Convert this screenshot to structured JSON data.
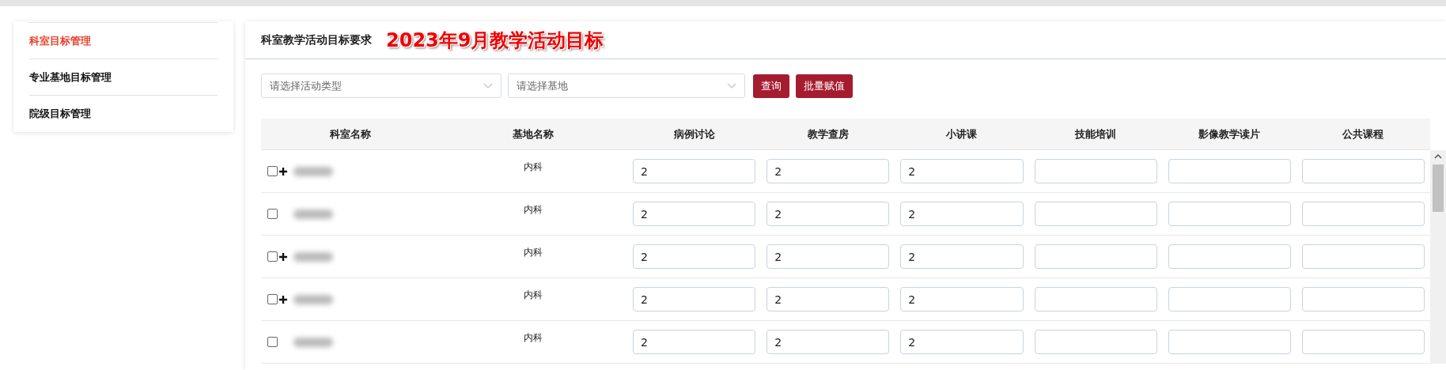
{
  "sidebar": {
    "items": [
      {
        "label": "科室目标管理",
        "selected": true
      },
      {
        "label": "专业基地目标管理",
        "selected": false
      },
      {
        "label": "院级目标管理",
        "selected": false
      }
    ]
  },
  "panel": {
    "title": "科室教学活动目标要求",
    "highlight": "2023年9月教学活动目标"
  },
  "filters": [
    {
      "placeholder": "请选择活动类型"
    },
    {
      "placeholder": "请选择基地"
    }
  ],
  "buttons": [
    "查询",
    "批量赋值"
  ],
  "table": {
    "columns": [
      "科室名称",
      "基地名称",
      "病例讨论",
      "教学查房",
      "小讲课",
      "技能培训",
      "影像教学读片",
      "公共课程"
    ],
    "rows": [
      {
        "checked": false,
        "expandable": true,
        "base": "内科",
        "values": [
          "2",
          "2",
          "2"
        ]
      },
      {
        "checked": false,
        "expandable": false,
        "base": "内科",
        "values": [
          "2",
          "2",
          "2"
        ]
      },
      {
        "checked": false,
        "expandable": true,
        "base": "内科",
        "values": [
          "2",
          "2",
          "2"
        ]
      },
      {
        "checked": false,
        "expandable": true,
        "base": "内科",
        "values": [
          "2",
          "2",
          "2"
        ]
      },
      {
        "checked": false,
        "expandable": false,
        "base": "内科",
        "values": [
          "2",
          "2",
          "2"
        ]
      }
    ]
  }
}
